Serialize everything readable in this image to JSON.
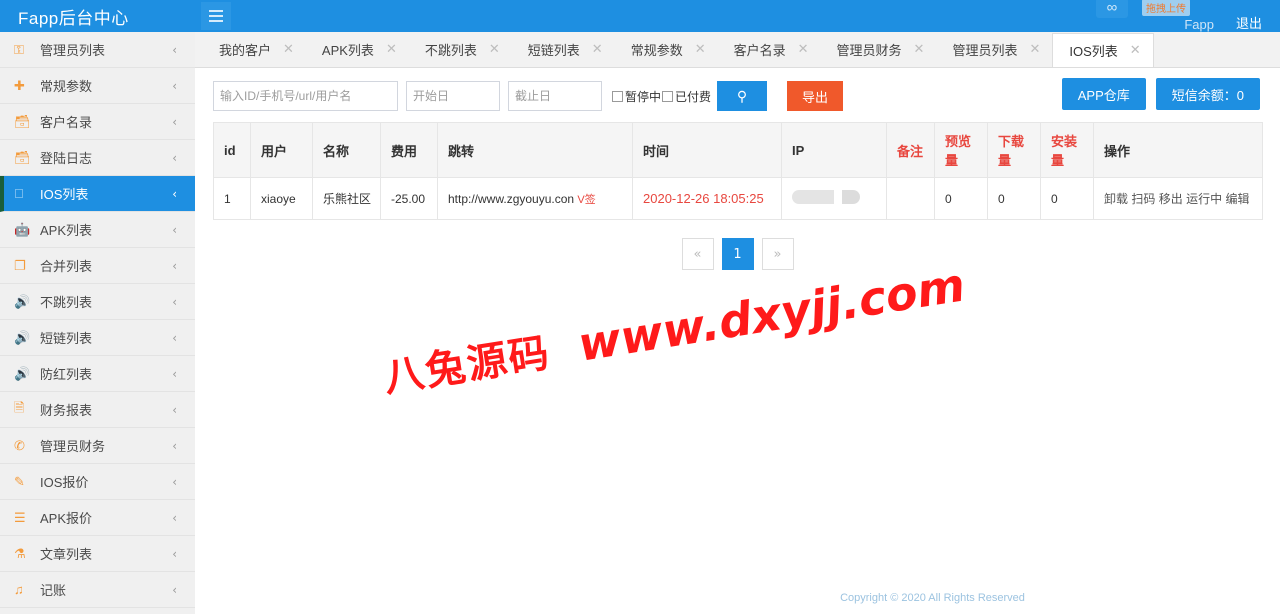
{
  "header": {
    "logo": "Fapp后台中心",
    "hamburger_icon": "hamburger-icon",
    "infinity_icon": "∞",
    "upload_tip": "拖拽上传",
    "user_name": "Fapp",
    "logout_label": "退出",
    "bg_color": "#1E8FE1"
  },
  "sidebar": {
    "items": [
      {
        "label": "管理员列表",
        "icon": "key-icon",
        "glyph": "⚿",
        "active": false
      },
      {
        "label": "常规参数",
        "icon": "plus-icon",
        "glyph": "✚",
        "active": false
      },
      {
        "label": "客户名录",
        "icon": "briefcase-icon",
        "glyph": "🗃",
        "active": false
      },
      {
        "label": "登陆日志",
        "icon": "briefcase-icon",
        "glyph": "🗃",
        "active": false
      },
      {
        "label": "IOS列表",
        "icon": "apple-icon",
        "glyph": "",
        "active": true
      },
      {
        "label": "APK列表",
        "icon": "android-icon",
        "glyph": "🤖",
        "active": false
      },
      {
        "label": "合并列表",
        "icon": "copy-icon",
        "glyph": "❐",
        "active": false
      },
      {
        "label": "不跳列表",
        "icon": "rss-icon",
        "glyph": "🔊",
        "active": false
      },
      {
        "label": "短链列表",
        "icon": "rss-icon",
        "glyph": "🔊",
        "active": false
      },
      {
        "label": "防红列表",
        "icon": "rss-icon",
        "glyph": "🔊",
        "active": false
      },
      {
        "label": "财务报表",
        "icon": "file-icon",
        "glyph": "🗎",
        "active": false
      },
      {
        "label": "管理员财务",
        "icon": "stethoscope-icon",
        "glyph": "✆",
        "active": false
      },
      {
        "label": "IOS报价",
        "icon": "pencil-icon",
        "glyph": "✎",
        "active": false
      },
      {
        "label": "APK报价",
        "icon": "list-icon",
        "glyph": "☰",
        "active": false
      },
      {
        "label": "文章列表",
        "icon": "flask-icon",
        "glyph": "⚗",
        "active": false
      },
      {
        "label": "记账",
        "icon": "music-icon",
        "glyph": "♫",
        "active": false
      }
    ],
    "arrow_glyph": "‹"
  },
  "tabs": [
    {
      "label": "我的客户",
      "active": false
    },
    {
      "label": "APK列表",
      "active": false
    },
    {
      "label": "不跳列表",
      "active": false
    },
    {
      "label": "短链列表",
      "active": false
    },
    {
      "label": "常规参数",
      "active": false
    },
    {
      "label": "客户名录",
      "active": false
    },
    {
      "label": "管理员财务",
      "active": false
    },
    {
      "label": "管理员列表",
      "active": false
    },
    {
      "label": "IOS列表",
      "active": true
    }
  ],
  "tab_close_glyph": "✕",
  "toolbar": {
    "search_placeholder": "输入ID/手机号/url/用户名",
    "search_value": "",
    "start_date_placeholder": "开始日",
    "start_date_value": "",
    "end_date_placeholder": "截止日",
    "end_date_value": "",
    "checkbox_paused_label": "暂停中",
    "checkbox_paid_label": "已付费",
    "search_button_icon": "search-icon",
    "search_button_glyph": "🔍",
    "export_label": "导出",
    "app_warehouse_label": "APP仓库",
    "sms_balance_label": "短信余额：0"
  },
  "table": {
    "columns": [
      {
        "label": "id",
        "red": false
      },
      {
        "label": "用户",
        "red": false
      },
      {
        "label": "名称",
        "red": false
      },
      {
        "label": "费用",
        "red": false
      },
      {
        "label": "跳转",
        "red": false
      },
      {
        "label": "时间",
        "red": false
      },
      {
        "label": "IP",
        "red": false
      },
      {
        "label": "备注",
        "red": true
      },
      {
        "label": "预览量",
        "red": true
      },
      {
        "label": "下载量",
        "red": true
      },
      {
        "label": "安装量",
        "red": true
      },
      {
        "label": "操作",
        "red": false
      }
    ],
    "rows": [
      {
        "id": "1",
        "user": "xiaoye",
        "name": "乐熊社区",
        "fee": "-25.00",
        "jump_url": "http://www.zgyouyu.con",
        "jump_tag": "V签",
        "time": "2020-12-26 18:05:25",
        "ip": "",
        "remark": "",
        "preview_count": "0",
        "download_count": "0",
        "install_count": "0",
        "ops": [
          "卸载",
          "扫码",
          "移出",
          "运行中",
          "编辑"
        ]
      }
    ]
  },
  "pagination": {
    "prev_glyph": "«",
    "next_glyph": "»",
    "pages": [
      "1"
    ],
    "current": "1"
  },
  "watermark": {
    "cn_text": "八兔源码",
    "url_text": "www.dxyjj.com",
    "color": "#ff1a1a"
  },
  "footer": {
    "text": "Copyright © 2020 All Rights Reserved"
  }
}
